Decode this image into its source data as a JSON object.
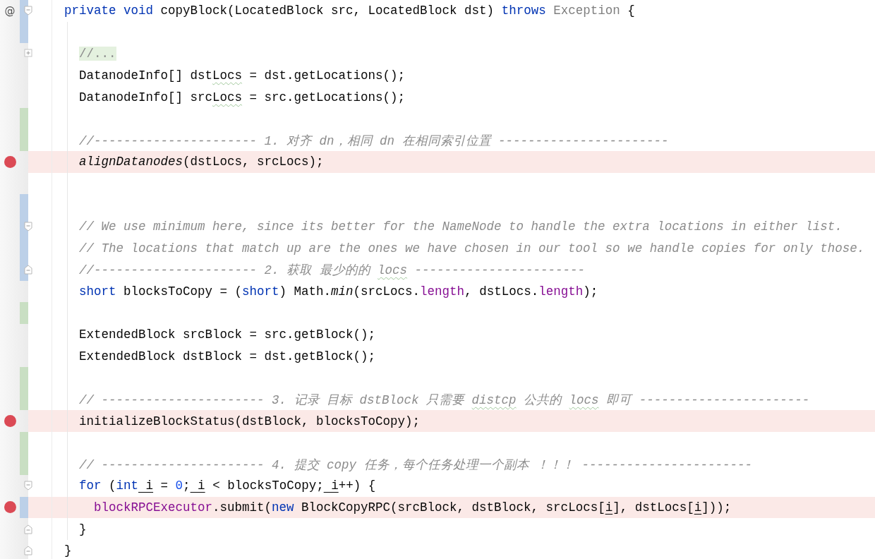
{
  "lines": [
    {
      "gutter_mark": "@",
      "breakpoint": false,
      "modified": true,
      "fold_start": true,
      "tokens": [
        {
          "text": "private void ",
          "kind": "keyword"
        },
        {
          "text": "copyBlock(LocatedBlock src, LocatedBlock dst) ",
          "kind": "plain"
        },
        {
          "text": "throws ",
          "kind": "keyword"
        },
        {
          "text": "Exception ",
          "kind": "unused"
        },
        {
          "text": "{",
          "kind": "plain"
        }
      ],
      "children": [
        {
          "breakpoint": false,
          "modified": true
        },
        {
          "breakpoint": false,
          "collapsed": true,
          "tokens": [
            {
              "text": "//...",
              "kind": "folded"
            }
          ]
        },
        {
          "breakpoint": false,
          "tokens": [
            {
              "text": "DatanodeInfo[] dst",
              "kind": "plain"
            },
            {
              "text": "Locs",
              "kind": "plain",
              "misspelled": true
            },
            {
              "text": " = dst.getLocations();",
              "kind": "plain"
            }
          ]
        },
        {
          "breakpoint": false,
          "tokens": [
            {
              "text": "DatanodeInfo[] src",
              "kind": "plain"
            },
            {
              "text": "Locs",
              "kind": "plain",
              "misspelled": true
            },
            {
              "text": " = src.getLocations();",
              "kind": "plain"
            }
          ]
        },
        {
          "breakpoint": false,
          "added": true
        },
        {
          "breakpoint": false,
          "added": true,
          "tokens": [
            {
              "text": "//---------------------- 1. 对齐 dn，相同 dn 在相同索引位置 -----------------------",
              "kind": "comment"
            }
          ]
        },
        {
          "breakpoint": true,
          "tokens": [
            {
              "text": "alignDatanodes",
              "kind": "static"
            },
            {
              "text": "(dstLocs, srcLocs);",
              "kind": "plain"
            }
          ]
        },
        {
          "breakpoint": false
        },
        {
          "breakpoint": false,
          "modified": true
        },
        {
          "breakpoint": false,
          "modified": true,
          "fold_start": true,
          "tokens": [
            {
              "text": "// We use minimum here, since its better for the NameNode to handle the extra locations in either list.",
              "kind": "comment"
            }
          ]
        },
        {
          "breakpoint": false,
          "modified": true,
          "tokens": [
            {
              "text": "// The locations that match up are the ones we have chosen in our tool so we handle copies for only those.",
              "kind": "comment"
            }
          ]
        },
        {
          "breakpoint": false,
          "modified": true,
          "fold_end": true,
          "tokens": [
            {
              "text": "//---------------------- 2. 获取 最少的的 ",
              "kind": "comment"
            },
            {
              "text": "locs",
              "kind": "comment",
              "misspelled": true
            },
            {
              "text": " -----------------------",
              "kind": "comment"
            }
          ]
        },
        {
          "breakpoint": false,
          "tokens": [
            {
              "text": "short",
              "kind": "keyword"
            },
            {
              "text": " blocksToCopy = (",
              "kind": "plain"
            },
            {
              "text": "short",
              "kind": "keyword"
            },
            {
              "text": ") Math.",
              "kind": "plain"
            },
            {
              "text": "min",
              "kind": "static"
            },
            {
              "text": "(srcLocs.",
              "kind": "plain"
            },
            {
              "text": "length",
              "kind": "field"
            },
            {
              "text": ", dstLocs.",
              "kind": "plain"
            },
            {
              "text": "length",
              "kind": "field"
            },
            {
              "text": ");",
              "kind": "plain"
            }
          ]
        },
        {
          "breakpoint": false,
          "added": true
        },
        {
          "breakpoint": false,
          "tokens": [
            {
              "text": "ExtendedBlock srcBlock = src.getBlock();",
              "kind": "plain"
            }
          ]
        },
        {
          "breakpoint": false,
          "tokens": [
            {
              "text": "ExtendedBlock dstBlock = dst.getBlock();",
              "kind": "plain"
            }
          ]
        },
        {
          "breakpoint": false,
          "added": true
        },
        {
          "breakpoint": false,
          "added": true,
          "tokens": [
            {
              "text": "// ---------------------- 3. 记录 目标 dstBlock 只需要 ",
              "kind": "comment"
            },
            {
              "text": "distcp",
              "kind": "comment",
              "misspelled": true
            },
            {
              "text": " 公共的 ",
              "kind": "comment"
            },
            {
              "text": "locs",
              "kind": "comment",
              "misspelled": true
            },
            {
              "text": " 即可 -----------------------",
              "kind": "comment"
            }
          ]
        },
        {
          "breakpoint": true,
          "tokens": [
            {
              "text": "initializeBlockStatus(dstBlock, blocksToCopy);",
              "kind": "plain"
            }
          ]
        },
        {
          "breakpoint": false,
          "added": true
        },
        {
          "breakpoint": false,
          "added": true,
          "tokens": [
            {
              "text": "// ---------------------- 4. 提交 copy 任务，每个任务处理一个副本 ！！！ -----------------------",
              "kind": "comment"
            }
          ]
        },
        {
          "breakpoint": false,
          "fold_start": true,
          "tokens": [
            {
              "text": "for",
              "kind": "keyword"
            },
            {
              "text": " (",
              "kind": "plain"
            },
            {
              "text": "int",
              "kind": "keyword"
            },
            {
              "text": " i",
              "kind": "plain",
              "reassigned": true
            },
            {
              "text": " = ",
              "kind": "plain"
            },
            {
              "text": "0",
              "kind": "number"
            },
            {
              "text": ";",
              "kind": "plain"
            },
            {
              "text": " i",
              "kind": "plain",
              "reassigned": true
            },
            {
              "text": " < blocksToCopy;",
              "kind": "plain"
            },
            {
              "text": " i",
              "kind": "plain",
              "reassigned": true
            },
            {
              "text": "++) {",
              "kind": "plain"
            }
          ],
          "children": [
            {
              "breakpoint": true,
              "modified": true,
              "tokens": [
                {
                  "text": "blockRPCExecutor",
                  "kind": "field"
                },
                {
                  "text": ".submit(",
                  "kind": "plain"
                },
                {
                  "text": "new",
                  "kind": "keyword"
                },
                {
                  "text": " BlockCopyRPC(srcBlock, dstBlock, srcLocs[",
                  "kind": "plain"
                },
                {
                  "text": "i",
                  "kind": "plain",
                  "reassigned": true
                },
                {
                  "text": "], dstLocs[",
                  "kind": "plain"
                },
                {
                  "text": "i",
                  "kind": "plain",
                  "reassigned": true
                },
                {
                  "text": "]));",
                  "kind": "plain"
                }
              ]
            }
          ]
        },
        {
          "breakpoint": false,
          "fold_end": true,
          "tokens": [
            {
              "text": "}",
              "kind": "plain"
            }
          ]
        }
      ]
    },
    {
      "breakpoint": false,
      "fold_end": true,
      "tokens": [
        {
          "text": "}",
          "kind": "plain"
        }
      ]
    }
  ]
}
